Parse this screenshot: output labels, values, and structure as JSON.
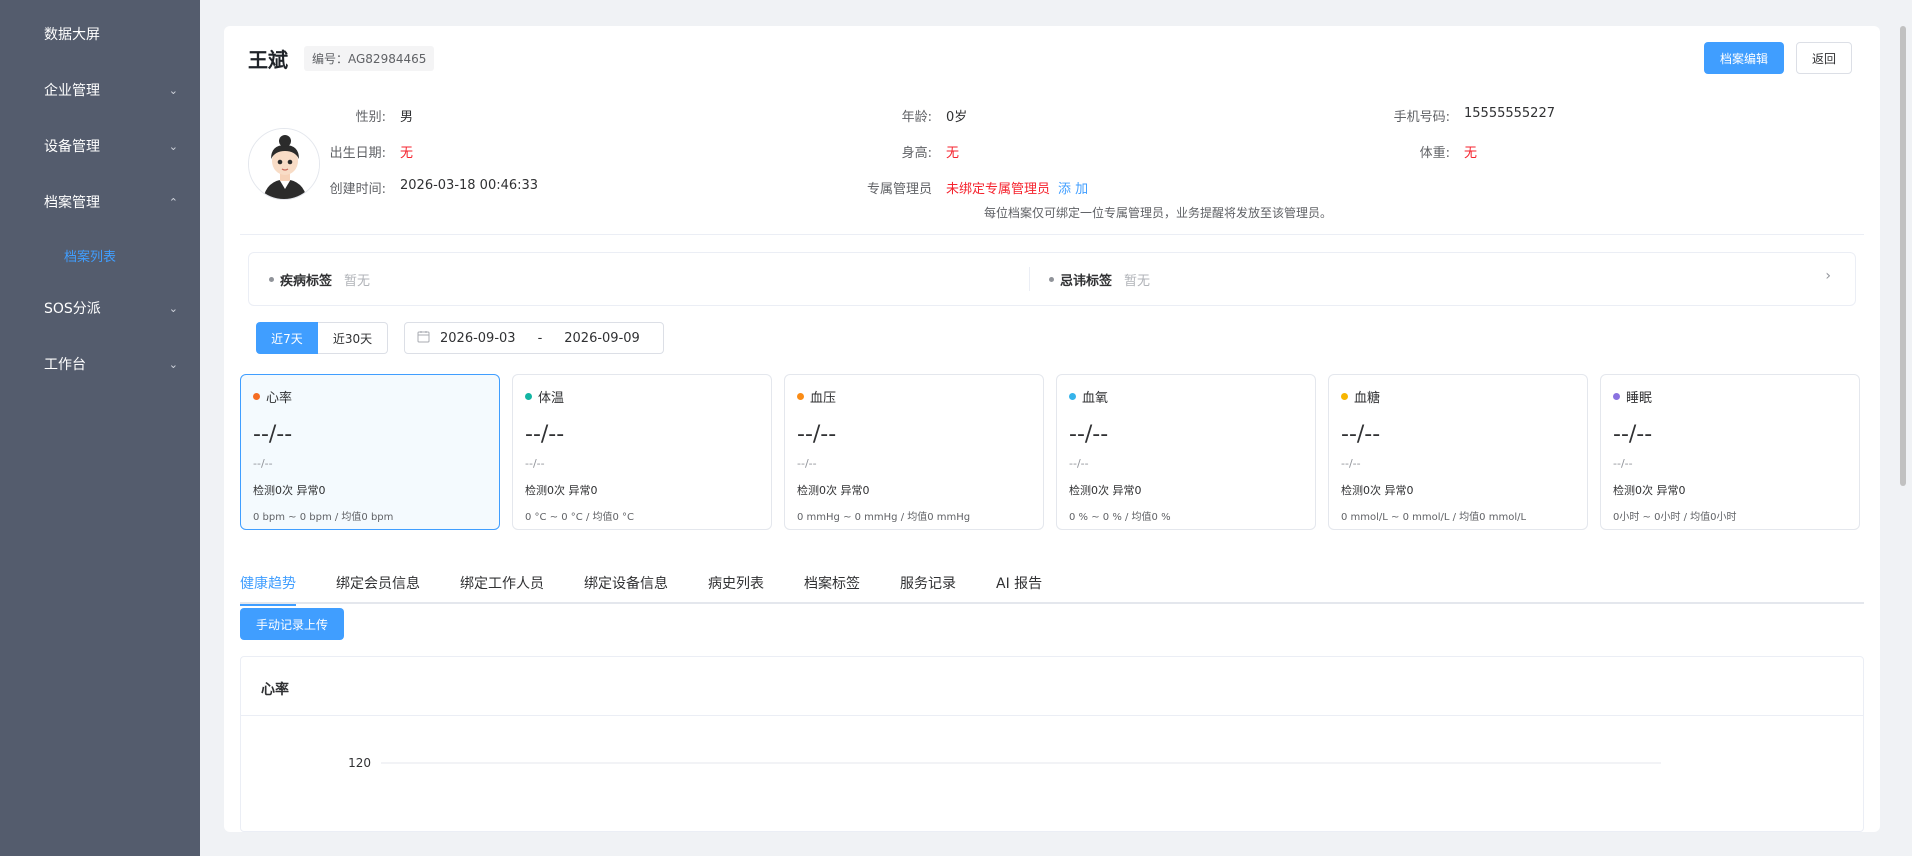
{
  "sidebar": {
    "items": [
      {
        "label": "数据大屏",
        "chevron": ""
      },
      {
        "label": "企业管理",
        "chevron": "⌄"
      },
      {
        "label": "设备管理",
        "chevron": "⌄"
      },
      {
        "label": "档案管理",
        "chevron": "⌃"
      },
      {
        "label": "档案列表"
      },
      {
        "label": "SOS分派",
        "chevron": "⌄"
      },
      {
        "label": "工作台",
        "chevron": "⌄"
      }
    ]
  },
  "profile": {
    "name": "王斌",
    "id_label": "编号：AG82984465",
    "edit_button": "档案编辑",
    "back_button": "返回",
    "fields": {
      "gender_label": "性别:",
      "gender": "男",
      "age_label": "年龄:",
      "age": "0岁",
      "phone_label": "手机号码:",
      "phone": "15555555227",
      "birth_label": "出生日期:",
      "birth": "无",
      "height_label": "身高:",
      "height": "无",
      "weight_label": "体重:",
      "weight": "无",
      "created_label": "创建时间:",
      "created": "2026-03-18 00:46:33",
      "manager_label": "专属管理员",
      "manager": "未绑定专属管理员",
      "manager_add": "添 加"
    },
    "hint": "每位档案仅可绑定一位专属管理员，业务提醒将发放至该管理员。"
  },
  "tags": {
    "disease_title": "疾病标签",
    "disease_value": "暂无",
    "taboo_title": "忌讳标签",
    "taboo_value": "暂无",
    "arrow": "›"
  },
  "filter": {
    "range_7": "近7天",
    "range_30": "近30天",
    "calendar_icon": "calendar-icon",
    "date_start": "2026-09-03",
    "date_sep": "-",
    "date_end": "2026-09-09"
  },
  "metrics": [
    {
      "name": "心率",
      "color": "#f56c23",
      "value": "--/--",
      "sub": "--/--",
      "count": "检测0次  异常0",
      "range": "0 bpm ~ 0 bpm / 均值0 bpm"
    },
    {
      "name": "体温",
      "color": "#13b5a3",
      "value": "--/--",
      "sub": "--/--",
      "count": "检测0次  异常0",
      "range": "0 °C ~ 0 °C / 均值0 °C"
    },
    {
      "name": "血压",
      "color": "#fa8c16",
      "value": "--/--",
      "sub": "--/--",
      "count": "检测0次  异常0",
      "range": "0 mmHg ~ 0 mmHg / 均值0 mmHg"
    },
    {
      "name": "血氧",
      "color": "#36b3ea",
      "value": "--/--",
      "sub": "--/--",
      "count": "检测0次  异常0",
      "range": "0 % ~ 0 % / 均值0 %"
    },
    {
      "name": "血糖",
      "color": "#f7b500",
      "value": "--/--",
      "sub": "--/--",
      "count": "检测0次  异常0",
      "range": "0 mmol/L ~ 0 mmol/L / 均值0 mmol/L"
    },
    {
      "name": "睡眠",
      "color": "#8a72e0",
      "value": "--/--",
      "sub": "--/--",
      "count": "检测0次  异常0",
      "range": "0小时 ~ 0小时 / 均值0小时"
    }
  ],
  "tabs": [
    "健康趋势",
    "绑定会员信息",
    "绑定工作人员",
    "绑定设备信息",
    "病史列表",
    "档案标签",
    "服务记录",
    "AI 报告"
  ],
  "upload_button": "手动记录上传",
  "chart_data": {
    "type": "line",
    "title": "心率",
    "yticks": [
      "120"
    ],
    "series": []
  }
}
